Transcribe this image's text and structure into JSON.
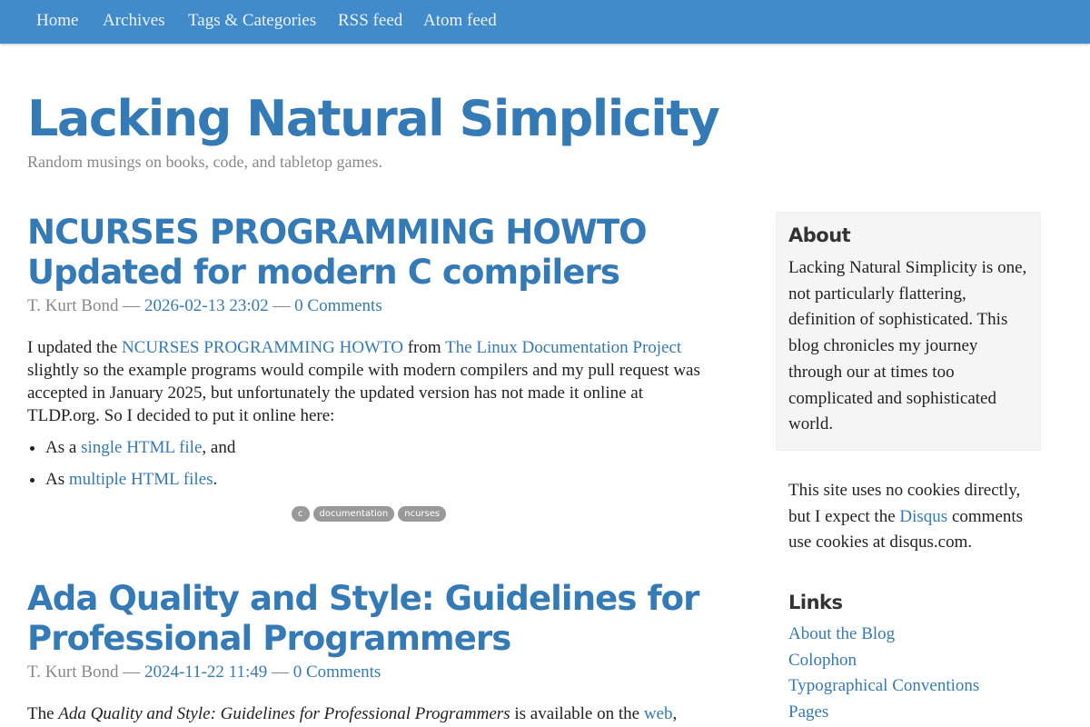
{
  "nav": {
    "home": "Home",
    "archives": "Archives",
    "tags": "Tags & Categories",
    "rss": "RSS feed",
    "atom": "Atom feed"
  },
  "site": {
    "title": "Lacking Natural Simplicity",
    "subtitle": "Random musings on books, code, and tabletop games."
  },
  "posts": [
    {
      "title_line1": "NCURSES PROGRAMMING HOWTO",
      "title_line2": "Updated for modern C compilers",
      "author": "T. Kurt Bond",
      "sep": " — ",
      "date": "2026-02-13 23:02",
      "comments": "0 Comments",
      "body_intro": "I updated the ",
      "link1": "NCURSES PROGRAMMING HOWTO",
      "body_from": " from ",
      "link2": "The Linux Documentation Project",
      "body_rest": " slightly so the example programs would compile with modern compilers and my pull request was accepted in January 2025, but unfortunately the updated version has not made it online at TLDP.org. So I decided to put it online here:",
      "li1_pre": "As a ",
      "li1_link": "single HTML file",
      "li1_post": ", and",
      "li2_pre": "As ",
      "li2_link": "multiple HTML files",
      "li2_post": ".",
      "tags": [
        "c",
        "documentation",
        "ncurses"
      ]
    },
    {
      "title_line1": "Ada Quality and Style: Guidelines for",
      "title_line2": "Professional Programmers",
      "author": "T. Kurt Bond",
      "sep": " — ",
      "date": "2024-11-22 11:49",
      "comments": "0 Comments",
      "body_intro": "The ",
      "body_em": "Ada Quality and Style: Guidelines for Professional Programmers",
      "body_mid": " is available on the ",
      "link1": "web",
      "body_end": ","
    }
  ],
  "sidebar": {
    "about_heading": "About",
    "about_text": "Lacking Natural Simplicity is one, not particularly flattering, definition of sophisticated. This blog chronicles my journey through our at times too complicated and sophisticated world.",
    "cookies_pre": "This site uses no cookies directly, but I expect the ",
    "cookies_link": "Disqus",
    "cookies_post": " comments use cookies at disqus.com.",
    "links_heading": "Links",
    "links": [
      "About the Blog",
      "Colophon",
      "Typographical Conventions",
      "Pages"
    ]
  },
  "colors": {
    "navbar": "#428bca",
    "link": "#337ab7",
    "muted": "#888888",
    "tag": "#999999",
    "well": "#f5f5f5"
  }
}
